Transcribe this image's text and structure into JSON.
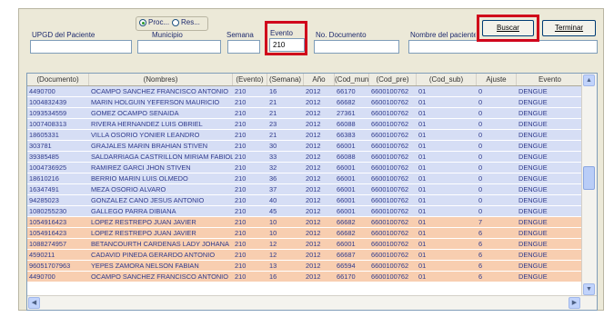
{
  "filters": {
    "upgd_label": "UPGD del Paciente",
    "proc_label": "Proc...",
    "res_label": "Res...",
    "municipio_label": "Municipio",
    "semana_label": "Semana",
    "evento_label": "Evento",
    "evento_value": "210",
    "documento_label": "No. Documento",
    "nombre_label": "Nombre del paciente"
  },
  "buttons": {
    "buscar": "Buscar",
    "terminar": "Terminar"
  },
  "columns": [
    "(Documento)",
    "(Nombres)",
    "(Evento)",
    "(Semana)",
    "Año",
    "(Cod_mun)",
    "(Cod_pre)",
    "(Cod_sub)",
    "Ajuste",
    "Evento"
  ],
  "rows": [
    {
      "doc": "4490700",
      "name": "OCAMPO SANCHEZ FRANCISCO ANTONIO",
      "evt": "210",
      "sem": "16",
      "anio": "2012",
      "mun": "66170",
      "pre": "6600100762",
      "sub": "01",
      "aj": "0",
      "evento": "DENGUE",
      "color": "blue"
    },
    {
      "doc": "1004832439",
      "name": "MARIN HOLGUIN YEFERSON MAURICIO",
      "evt": "210",
      "sem": "21",
      "anio": "2012",
      "mun": "66682",
      "pre": "6600100762",
      "sub": "01",
      "aj": "0",
      "evento": "DENGUE",
      "color": "blue"
    },
    {
      "doc": "1093534559",
      "name": "GOMEZ OCAMPO SENAIDA",
      "evt": "210",
      "sem": "21",
      "anio": "2012",
      "mun": "27361",
      "pre": "6600100762",
      "sub": "01",
      "aj": "0",
      "evento": "DENGUE",
      "color": "blue"
    },
    {
      "doc": "1007408313",
      "name": "RIVERA HERNANDEZ LUIS OBRIEL",
      "evt": "210",
      "sem": "23",
      "anio": "2012",
      "mun": "66088",
      "pre": "6600100762",
      "sub": "01",
      "aj": "0",
      "evento": "DENGUE",
      "color": "blue"
    },
    {
      "doc": "18605331",
      "name": "VILLA OSORIO YONIER LEANDRO",
      "evt": "210",
      "sem": "21",
      "anio": "2012",
      "mun": "66383",
      "pre": "6600100762",
      "sub": "01",
      "aj": "0",
      "evento": "DENGUE",
      "color": "blue"
    },
    {
      "doc": "303781",
      "name": "GRAJALES MARIN BRAHIAN STIVEN",
      "evt": "210",
      "sem": "30",
      "anio": "2012",
      "mun": "66001",
      "pre": "6600100762",
      "sub": "01",
      "aj": "0",
      "evento": "DENGUE",
      "color": "blue"
    },
    {
      "doc": "39385485",
      "name": "SALDARRIAGA CASTRILLON MIRIAM FABIOLA",
      "evt": "210",
      "sem": "33",
      "anio": "2012",
      "mun": "66088",
      "pre": "6600100762",
      "sub": "01",
      "aj": "0",
      "evento": "DENGUE",
      "color": "blue"
    },
    {
      "doc": "1004736925",
      "name": "RAMIREZ GARCI JHON STIVEN",
      "evt": "210",
      "sem": "32",
      "anio": "2012",
      "mun": "66001",
      "pre": "6600100762",
      "sub": "01",
      "aj": "0",
      "evento": "DENGUE",
      "color": "blue"
    },
    {
      "doc": "18610216",
      "name": "BERRIO MARIN LUIS OLMEDO",
      "evt": "210",
      "sem": "36",
      "anio": "2012",
      "mun": "66001",
      "pre": "6600100762",
      "sub": "01",
      "aj": "0",
      "evento": "DENGUE",
      "color": "blue"
    },
    {
      "doc": "16347491",
      "name": "MEZA OSORIO ALVARO",
      "evt": "210",
      "sem": "37",
      "anio": "2012",
      "mun": "66001",
      "pre": "6600100762",
      "sub": "01",
      "aj": "0",
      "evento": "DENGUE",
      "color": "blue"
    },
    {
      "doc": "94285023",
      "name": "GONZALEZ CANO JESUS ANTONIO",
      "evt": "210",
      "sem": "40",
      "anio": "2012",
      "mun": "66001",
      "pre": "6600100762",
      "sub": "01",
      "aj": "0",
      "evento": "DENGUE",
      "color": "blue"
    },
    {
      "doc": "1080255230",
      "name": "GALLEGO PARRA DIBIANA",
      "evt": "210",
      "sem": "45",
      "anio": "2012",
      "mun": "66001",
      "pre": "6600100762",
      "sub": "01",
      "aj": "0",
      "evento": "DENGUE",
      "color": "blue"
    },
    {
      "doc": "1054916423",
      "name": "LOPEZ RESTREPO JUAN JAVIER",
      "evt": "210",
      "sem": "10",
      "anio": "2012",
      "mun": "66682",
      "pre": "6600100762",
      "sub": "01",
      "aj": "7",
      "evento": "DENGUE",
      "color": "orange"
    },
    {
      "doc": "1054916423",
      "name": "LOPEZ RESTREPO JUAN JAVIER",
      "evt": "210",
      "sem": "10",
      "anio": "2012",
      "mun": "66682",
      "pre": "6600100762",
      "sub": "01",
      "aj": "6",
      "evento": "DENGUE",
      "color": "orange"
    },
    {
      "doc": "1088274957",
      "name": "BETANCOURTH CARDENAS LADY JOHANA",
      "evt": "210",
      "sem": "12",
      "anio": "2012",
      "mun": "66001",
      "pre": "6600100762",
      "sub": "01",
      "aj": "6",
      "evento": "DENGUE",
      "color": "orange"
    },
    {
      "doc": "4590211",
      "name": "CADAVID PINEDA GERARDO ANTONIO",
      "evt": "210",
      "sem": "12",
      "anio": "2012",
      "mun": "66687",
      "pre": "6600100762",
      "sub": "01",
      "aj": "6",
      "evento": "DENGUE",
      "color": "orange"
    },
    {
      "doc": "96051707963",
      "name": "YEPES ZAMORA NELSON FABIAN",
      "evt": "210",
      "sem": "13",
      "anio": "2012",
      "mun": "66594",
      "pre": "6600100762",
      "sub": "01",
      "aj": "6",
      "evento": "DENGUE",
      "color": "orange"
    },
    {
      "doc": "4490700",
      "name": "OCAMPO SANCHEZ FRANCISCO ANTONIO",
      "evt": "210",
      "sem": "16",
      "anio": "2012",
      "mun": "66170",
      "pre": "6600100762",
      "sub": "01",
      "aj": "6",
      "evento": "DENGUE",
      "color": "orange"
    }
  ],
  "highlight_color": "#d0021b",
  "row_colors": {
    "blue": "#d6def5",
    "orange": "#f8ceb0"
  }
}
